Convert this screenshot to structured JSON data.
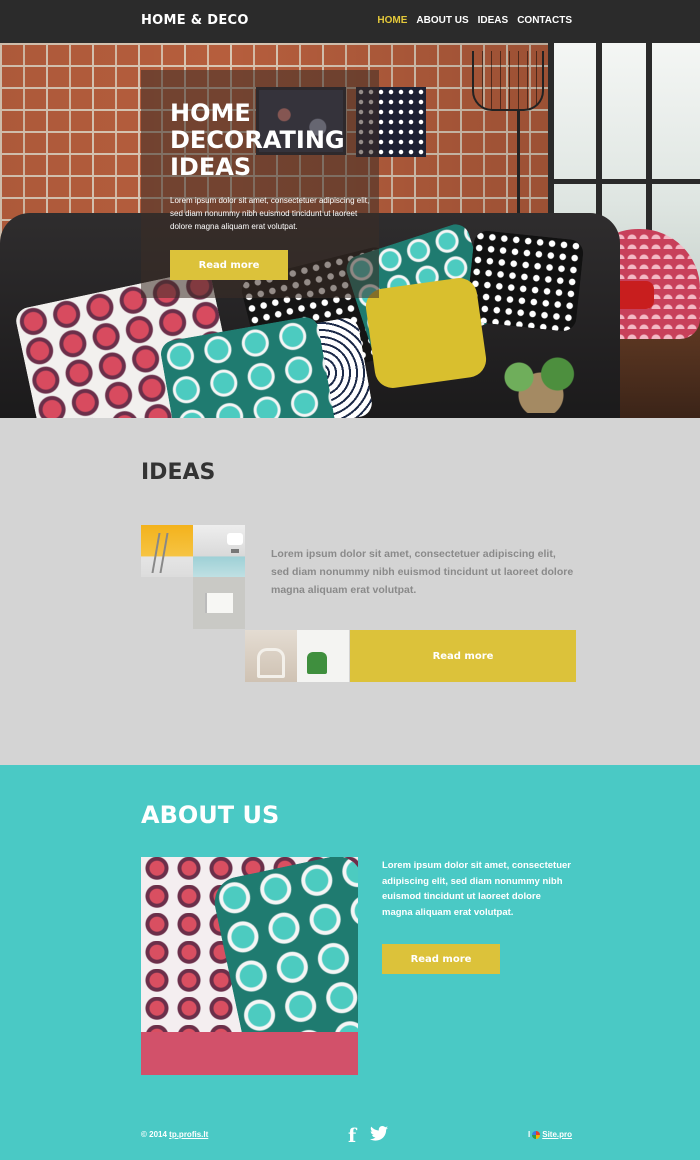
{
  "header": {
    "logo": "HOME & DECO",
    "nav": [
      {
        "label": "HOME",
        "active": true
      },
      {
        "label": "ABOUT US",
        "active": false
      },
      {
        "label": "IDEAS",
        "active": false
      },
      {
        "label": "CONTACTS",
        "active": false
      }
    ]
  },
  "hero": {
    "title": "HOME DECORATING IDEAS",
    "text": "Lorem ipsum dolor sit amet, consectetuer adipiscing elit, sed diam nonummy nibh euismod tincidunt ut laoreet dolore magna aliquam erat volutpat.",
    "button": "Read more"
  },
  "ideas": {
    "title": "IDEAS",
    "text": "Lorem ipsum dolor sit amet, consectetuer adipiscing elit, sed diam nonummy nibh euismod tincidunt ut laoreet dolore magna aliquam erat volutpat.",
    "button": "Read more"
  },
  "about": {
    "title": "ABOUT US",
    "text": "Lorem ipsum dolor sit amet, consectetuer adipiscing elit, sed diam nonummy nibh euismod tincidunt ut laoreet dolore magna aliquam erat volutpat.",
    "button": "Read more"
  },
  "footer": {
    "copyright_prefix": "© 2014",
    "copyright_link": "tp.profis.lt",
    "facebook_glyph": "f",
    "twitter_glyph": "🐦",
    "sitepro_prefix": "I",
    "sitepro_link": "Site.pro"
  },
  "colors": {
    "header_bg": "#2b2b2b",
    "accent_yellow": "#dcc23a",
    "ideas_bg": "#d4d4d4",
    "about_bg": "#4ac9c5",
    "about_bar": "#d2516a"
  },
  "icons": [
    "facebook-icon",
    "twitter-icon",
    "sitepro-heart-icon"
  ]
}
